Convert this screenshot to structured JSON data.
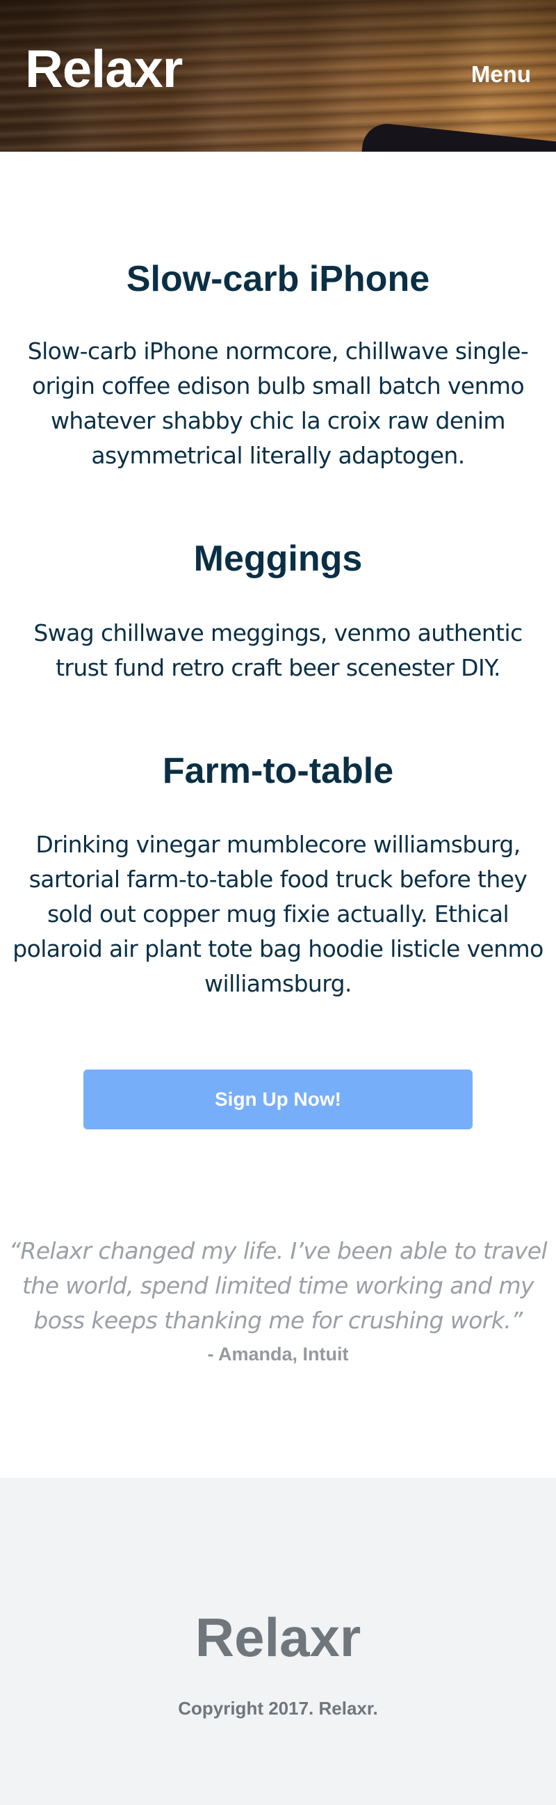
{
  "header": {
    "logo": "Relaxr",
    "menu_label": "Menu"
  },
  "sections": [
    {
      "title": "Slow-carb iPhone",
      "text": "Slow-carb iPhone normcore, chillwave single-origin coffee edison bulb small batch venmo whatever shabby chic la croix raw denim asymmetrical literally adaptogen."
    },
    {
      "title": "Meggings",
      "text": "Swag chillwave meggings, venmo authentic trust fund retro craft beer scenester DIY."
    },
    {
      "title": "Farm-to-table",
      "text": "Drinking vinegar mumblecore williamsburg, sartorial farm-to-table food truck before they sold out copper mug fixie actually. Ethical polaroid air plant tote bag hoodie listicle venmo williamsburg."
    }
  ],
  "cta": {
    "label": "Sign Up Now!"
  },
  "testimonial": {
    "quote": "“Relaxr changed my life. I’ve been able to travel the world, spend limited time working and my boss keeps thanking me for crushing work.”",
    "author": "- Amanda, Intuit"
  },
  "footer": {
    "logo": "Relaxr",
    "copyright": "Copyright 2017. Relaxr."
  },
  "colors": {
    "heading": "#0a2f45",
    "cta_background": "#76aefa",
    "quote_text": "#9aa0a6",
    "footer_background": "#f1f3f5",
    "footer_text": "#6f767c"
  }
}
